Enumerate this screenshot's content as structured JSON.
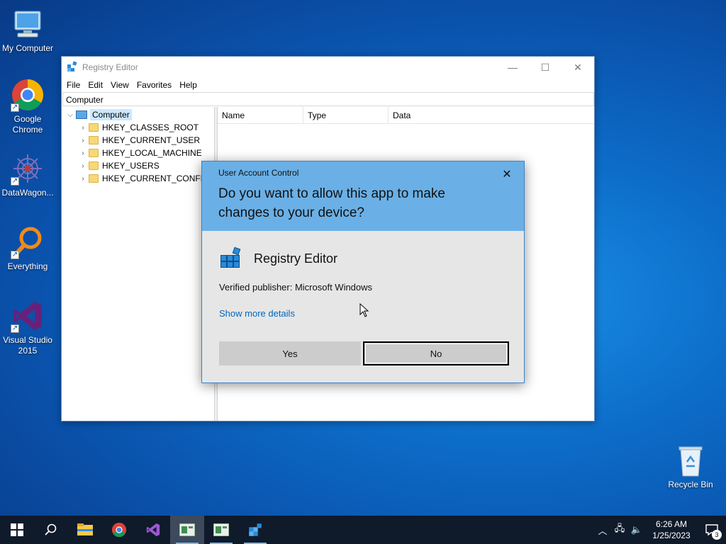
{
  "desktop": {
    "icons": [
      {
        "label": "My Computer",
        "icon": "computer-icon"
      },
      {
        "label": "Google Chrome",
        "icon": "chrome-icon"
      },
      {
        "label": "DataWagon...",
        "icon": "datawagon-icon"
      },
      {
        "label": "Everything",
        "icon": "everything-search-icon"
      },
      {
        "label": "Visual Studio 2015",
        "icon": "visual-studio-icon"
      },
      {
        "label": "Recycle Bin",
        "icon": "recycle-bin-icon"
      }
    ]
  },
  "regedit": {
    "title": "Registry Editor",
    "menu": [
      "File",
      "Edit",
      "View",
      "Favorites",
      "Help"
    ],
    "address": "Computer",
    "tree_root": "Computer",
    "hives": [
      "HKEY_CLASSES_ROOT",
      "HKEY_CURRENT_USER",
      "HKEY_LOCAL_MACHINE",
      "HKEY_USERS",
      "HKEY_CURRENT_CONFIG"
    ],
    "columns": [
      "Name",
      "Type",
      "Data"
    ]
  },
  "uac": {
    "kicker": "User Account Control",
    "question": "Do you want to allow this app to make changes to your device?",
    "app_name": "Registry Editor",
    "publisher": "Verified publisher: Microsoft Windows",
    "details_link": "Show more details",
    "yes_label": "Yes",
    "no_label": "No"
  },
  "taskbar": {
    "time": "6:26 AM",
    "date": "1/25/2023",
    "notification_count": "3"
  },
  "colors": {
    "uac_header": "#6ab0e6",
    "link": "#0067c0",
    "taskbar": "#0f1a2a"
  }
}
